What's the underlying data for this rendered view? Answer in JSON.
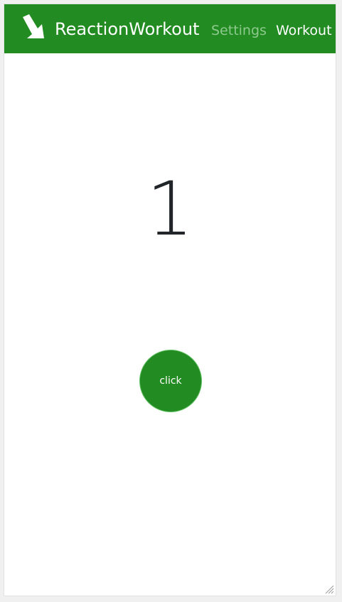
{
  "navbar": {
    "brand_title": "ReactionWorkout",
    "brand_icon": "arrow-logo-icon",
    "links": [
      {
        "label": "Settings",
        "active": false
      },
      {
        "label": "Workout",
        "active": true
      }
    ]
  },
  "main": {
    "counter": "1",
    "click_label": "click"
  },
  "colors": {
    "brand_green": "#228b22",
    "inactive_link": "#8dc98d",
    "counter_text": "#212529"
  }
}
